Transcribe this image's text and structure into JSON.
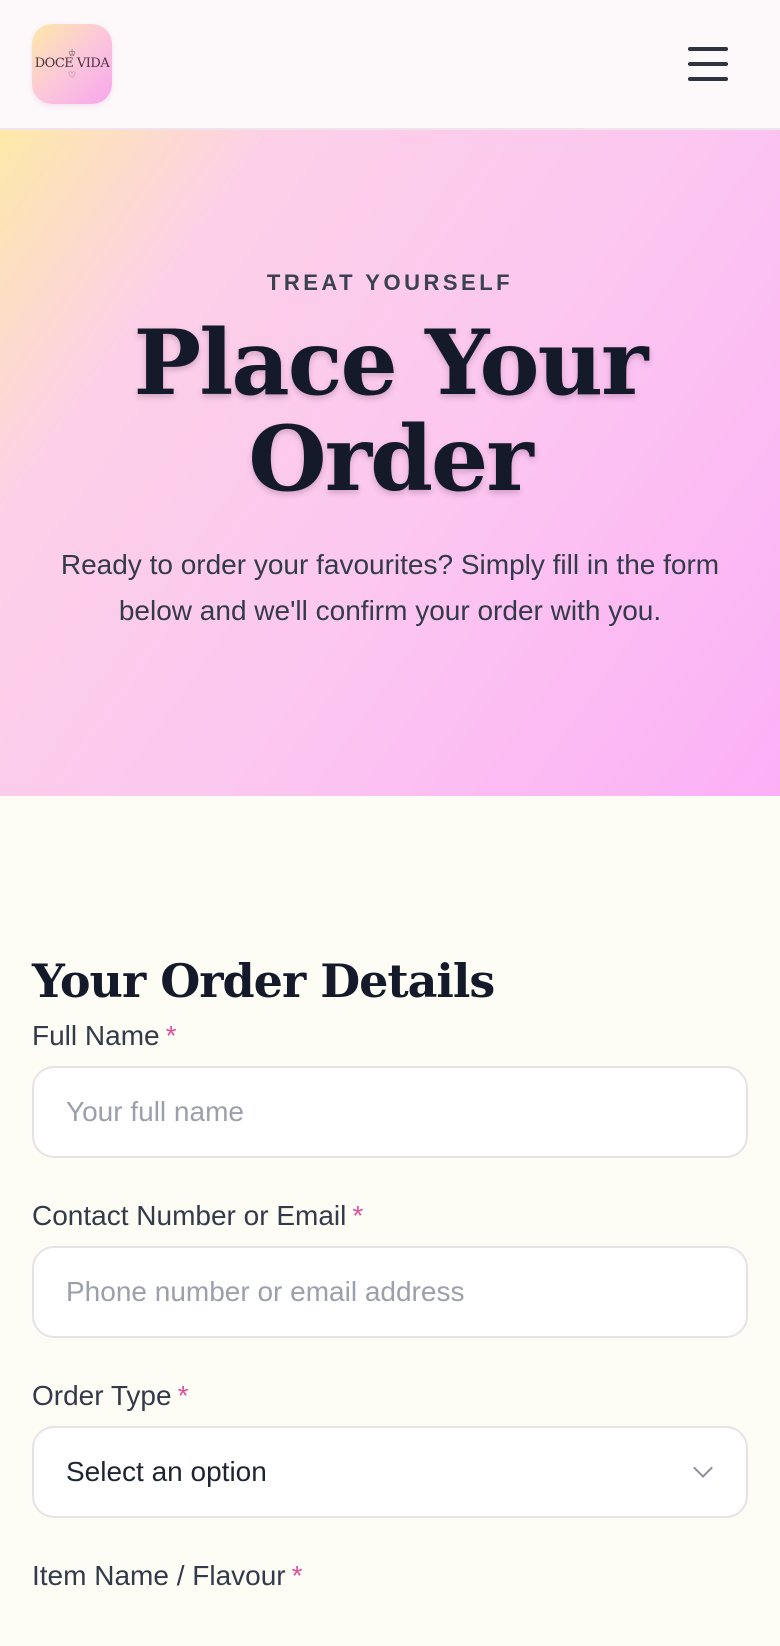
{
  "header": {
    "logo_text": "DOCE VIDA",
    "menu_icon": "hamburger-icon"
  },
  "hero": {
    "eyebrow": "TREAT YOURSELF",
    "title": "Place Your Order",
    "subtitle": "Ready to order your favourites? Simply fill in the form below and we'll confirm your order with you."
  },
  "form": {
    "title": "Your Order Details",
    "required_mark": "*",
    "fields": [
      {
        "label": "Full Name",
        "placeholder": "Your full name"
      },
      {
        "label": "Contact Number or Email",
        "placeholder": "Phone number or email address"
      },
      {
        "label": "Order Type",
        "selected": "Select an option"
      },
      {
        "label": "Item Name / Flavour"
      }
    ]
  },
  "colors": {
    "accent_pink": "#e0509a",
    "heading": "#151a2b",
    "background": "#fdfcf5"
  }
}
